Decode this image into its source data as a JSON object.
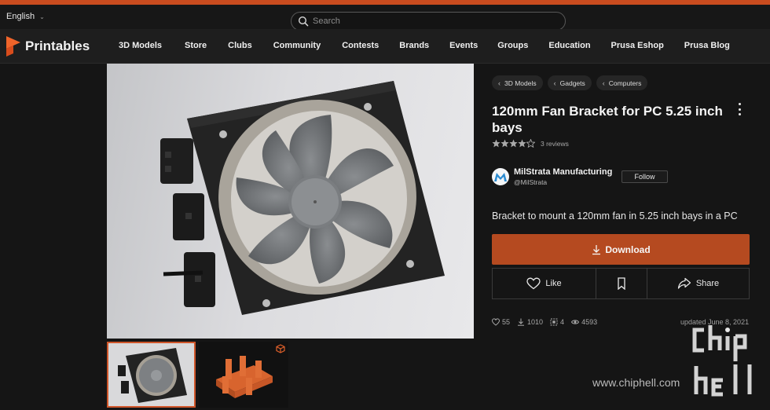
{
  "top_bar": {
    "language": "English",
    "search_placeholder": "Search"
  },
  "brand": {
    "name": "Printables",
    "accent_color": "#c94c1f"
  },
  "nav": {
    "items": [
      "3D Models",
      "Store",
      "Clubs",
      "Community",
      "Contests",
      "Brands",
      "Events",
      "Groups",
      "Education",
      "Prusa Eshop",
      "Prusa Blog"
    ]
  },
  "breadcrumbs": [
    "3D Models",
    "Gadgets",
    "Computers"
  ],
  "model": {
    "title": "120mm Fan Bracket for PC 5.25 inch bays",
    "rating": 4,
    "rating_max": 5,
    "reviews": "3 reviews",
    "summary": "Bracket to mount a 120mm fan in 5.25 inch bays in a PC"
  },
  "author": {
    "name": "MilStrata Manufacturing",
    "handle": "@MilStrata",
    "follow_label": "Follow"
  },
  "actions": {
    "download_label": "Download",
    "like_label": "Like",
    "bookmark_icon": "bookmark-icon",
    "share_label": "Share"
  },
  "stats": {
    "likes": "55",
    "downloads": "1010",
    "makes": "4",
    "views": "4593",
    "updated": "updated June 8, 2021"
  },
  "gallery": {
    "thumbnails": [
      "photo",
      "3d-render"
    ]
  },
  "watermark": {
    "url": "www.chiphell.com",
    "logo_text": "chiphell"
  }
}
